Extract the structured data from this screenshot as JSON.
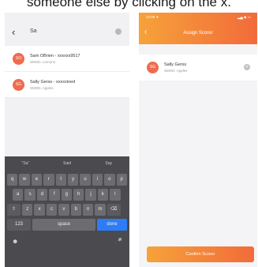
{
  "caption": "someone else by clicking on the x.",
  "search_screen": {
    "query": "Sa",
    "results": [
      {
        "initials": "SO",
        "name": "Sam OBrien - xxxxxx9517",
        "sub": "SMOD, Lemons"
      },
      {
        "initials": "SG",
        "name": "Sally Gerss - xxxxxined",
        "sub": "SMOD, Apples"
      }
    ],
    "keyboard": {
      "suggestions": [
        "\"Sa\"",
        "Said",
        "Say"
      ],
      "row1": [
        "q",
        "w",
        "e",
        "r",
        "t",
        "y",
        "u",
        "i",
        "o",
        "p"
      ],
      "row2": [
        "a",
        "s",
        "d",
        "f",
        "g",
        "h",
        "j",
        "k",
        "l"
      ],
      "row3": [
        "z",
        "x",
        "c",
        "v",
        "b",
        "n",
        "m"
      ],
      "shift": "⇧",
      "backspace": "⌫",
      "numbers_key": "123",
      "space_key": "space",
      "done_key": "done",
      "emoji_icon": "☻",
      "mic_icon": "🎤"
    }
  },
  "assign_screen": {
    "status_time": "12:08 ✈",
    "status_icons": "▂▄ ◆ ▭",
    "title": "Assign Scorer",
    "selected": {
      "initials": "SG",
      "name": "Sally Gerss",
      "sub": "SMOD, Apples"
    },
    "confirm_label": "Confirm Scorer"
  },
  "colors": {
    "accent_orange": "#f26b3a",
    "accent_yellow": "#f6a23a",
    "done_blue": "#2d7cf6"
  }
}
